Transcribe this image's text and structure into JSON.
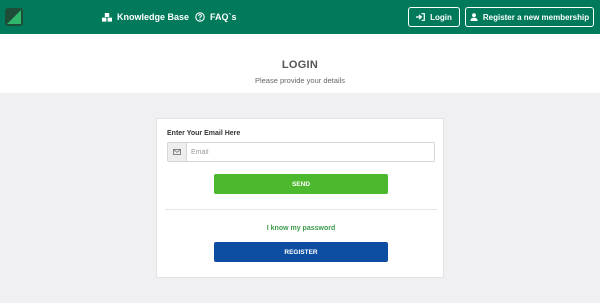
{
  "topbar": {
    "nav": [
      {
        "label": "Knowledge Base",
        "icon": "knowledge-base-icon"
      },
      {
        "label": "FAQ`s",
        "icon": "question-circle-icon"
      }
    ],
    "login_label": "Login",
    "register_label": "Register a new membership"
  },
  "header": {
    "title": "LOGIN",
    "subtitle": "Please provide your details"
  },
  "form": {
    "email_label": "Enter Your Email Here",
    "email_placeholder": "Email",
    "email_value": "",
    "send_label": "SEND",
    "know_password_label": "I know my password",
    "register_label": "REGISTER"
  },
  "colors": {
    "topbar": "#007a5a",
    "send_button": "#4cb82d",
    "register_button": "#0d4ea2",
    "link": "#3f9a4b"
  }
}
